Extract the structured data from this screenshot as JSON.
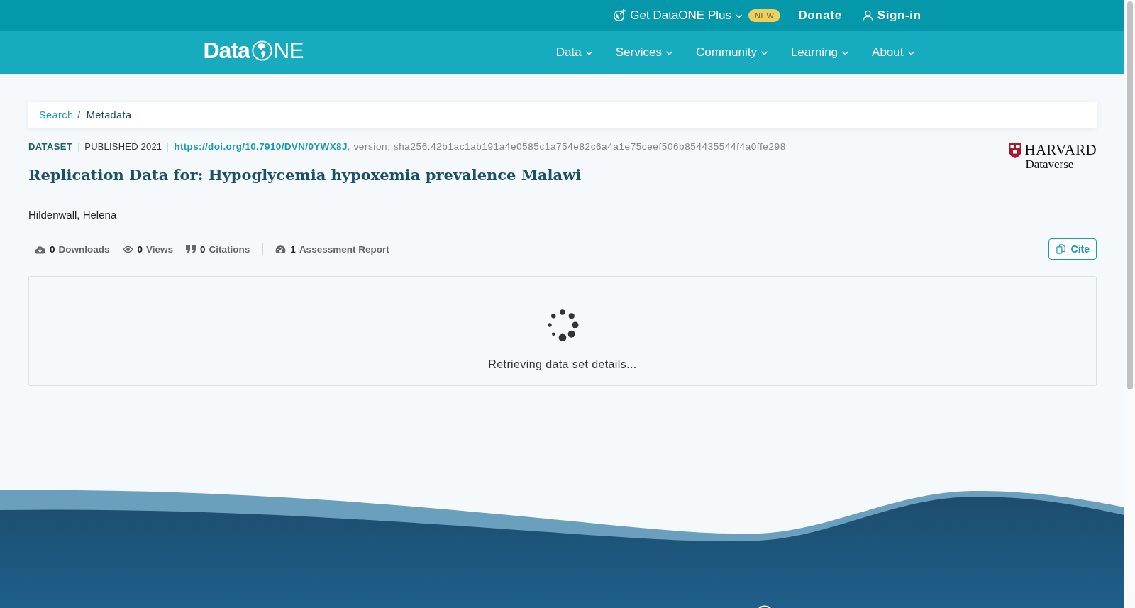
{
  "top_bar": {
    "items": [
      {
        "kind": "plus",
        "label": "Get DataONE Plus",
        "badge": "NEW"
      },
      {
        "kind": "donate",
        "label": "Donate"
      },
      {
        "kind": "sign_in",
        "label": "Sign-in"
      }
    ]
  },
  "nav_bar": {
    "logo": {
      "text": "Data",
      "suffix": "NE"
    },
    "items": [
      {
        "label": "Data"
      },
      {
        "label": "Services"
      },
      {
        "label": "Community"
      },
      {
        "label": "Learning"
      },
      {
        "label": "About"
      }
    ]
  },
  "breadcrumb": {
    "separator": "/",
    "items": [
      {
        "label": "Search",
        "current": false
      },
      {
        "label": "Metadata",
        "current": true
      }
    ]
  },
  "dataset": {
    "type": "DATASET",
    "published": "PUBLISHED 2021",
    "doi": "https://doi.org/10.7910/DVN/0YWX8J",
    "version": ", version: sha256:42b1ac1ab191a4e0585c1a754e82c6a4a1e75ceef506b854435544f4a0ffe298",
    "title": "Replication Data for: Hypoglycemia hypoxemia prevalence Malawi",
    "authors": "Hildenwall, Helena"
  },
  "repository": {
    "name": "HARVARD",
    "subtitle": "Dataverse"
  },
  "metrics": [
    {
      "kind": "downloads",
      "count": "0",
      "label": "Downloads"
    },
    {
      "kind": "views",
      "count": "0",
      "label": "Views"
    },
    {
      "kind": "citations",
      "count": "0",
      "label": "Citations"
    },
    {
      "kind": "assessment",
      "count": "1",
      "label": "Assessment Report"
    }
  ],
  "cite_button": {
    "label": "Cite"
  },
  "loading": {
    "message": "Retrieving data set details..."
  }
}
